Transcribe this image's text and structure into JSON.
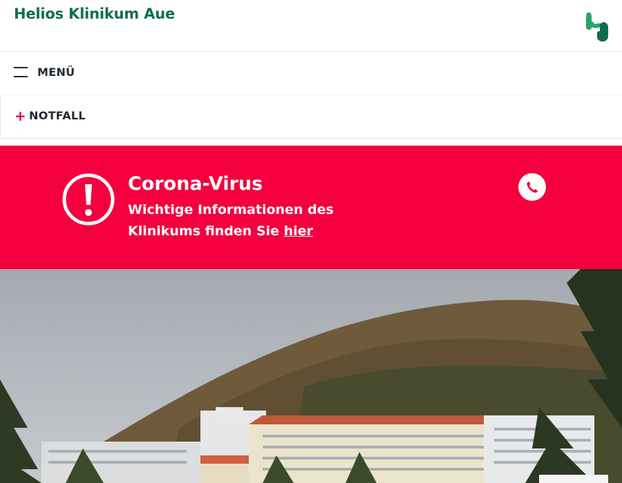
{
  "header": {
    "title": "Helios Klinikum Aue",
    "logo_icon": "helios-logo-icon"
  },
  "nav": {
    "menu_label": "MENÜ",
    "menu_icon": "hamburger-icon",
    "emergency_label": "NOTFALL",
    "emergency_icon": "plus-icon"
  },
  "banner": {
    "title": "Corona-Virus",
    "text_before_link": "Wichtige Informationen des Klinikums finden Sie ",
    "link_text": "hier",
    "alert_icon": "exclamation-circle-icon",
    "phone_icon": "phone-icon",
    "background": "#f4003f"
  },
  "hero": {
    "image": "clinic-building-photo"
  },
  "colors": {
    "brand_green": "#0f6e4f",
    "accent_red": "#e4003b"
  }
}
